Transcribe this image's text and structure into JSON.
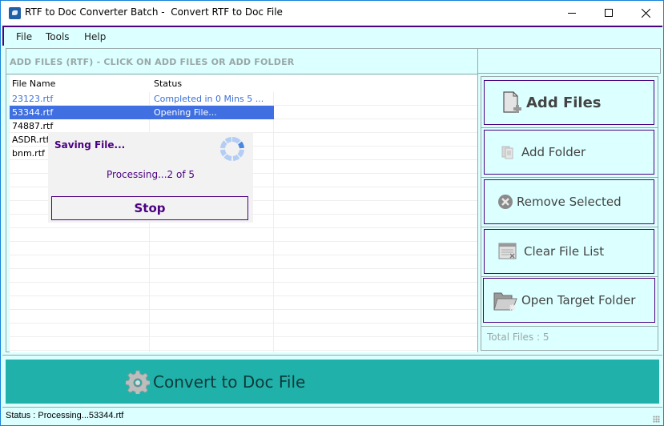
{
  "window": {
    "title": "RTF to Doc Converter Batch -  Convert RTF to Doc File",
    "controls": {
      "minimize": "minimize",
      "maximize": "maximize",
      "close": "close"
    }
  },
  "menu": {
    "items": [
      {
        "label": "File"
      },
      {
        "label": "Tools"
      },
      {
        "label": "Help"
      }
    ]
  },
  "file_panel": {
    "header": "ADD FILES (RTF) - CLICK ON ADD FILES OR ADD FOLDER",
    "columns": [
      "File Name",
      "Status"
    ],
    "rows": [
      {
        "name": "23123.rtf",
        "status": "Completed in 0 Mins 5 ...",
        "state": "done"
      },
      {
        "name": "53344.rtf",
        "status": "Opening File...",
        "state": "selected"
      },
      {
        "name": "74887.rtf",
        "status": "",
        "state": "pending"
      },
      {
        "name": "ASDR.rtf",
        "status": "",
        "state": "pending"
      },
      {
        "name": "bnm.rtf",
        "status": "",
        "state": "pending"
      }
    ]
  },
  "progress_dialog": {
    "title": "Saving File...",
    "message": "Processing...2 of 5",
    "stop_label": "Stop",
    "spinner_icon": "loading-spinner-icon"
  },
  "actions": {
    "add_files": {
      "label": "Add Files",
      "icon": "add-file-icon"
    },
    "add_folder": {
      "label": "Add Folder",
      "icon": "folder-icon"
    },
    "remove_selected": {
      "label": "Remove Selected",
      "icon": "remove-icon"
    },
    "clear_file_list": {
      "label": "Clear File List",
      "icon": "clear-list-icon"
    },
    "open_target_folder": {
      "label": "Open Target Folder",
      "icon": "open-folder-icon"
    },
    "total_files": "Total Files : 5"
  },
  "convert": {
    "label": "Convert to Doc File",
    "icon": "gear-icon"
  },
  "status_bar": {
    "text": "Status  :  Processing...53344.rtf"
  },
  "colors": {
    "panel_bg": "#dcffff",
    "accent_purple": "#4b0082",
    "convert_teal": "#20b2aa",
    "selection_blue": "#3f6fe0",
    "done_blue": "#3a6fd8",
    "border_gray": "#9aa7a7"
  }
}
